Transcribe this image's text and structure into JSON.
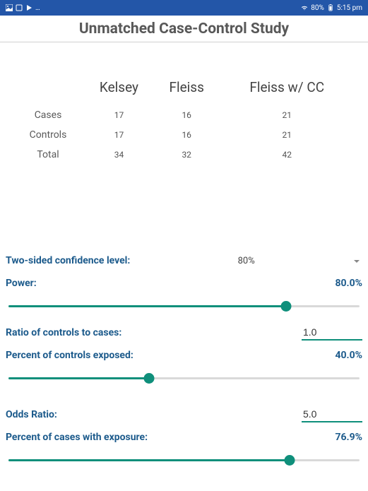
{
  "status": {
    "icons_left": [
      "image-icon",
      "square-icon",
      "play-icon",
      "…"
    ],
    "wifi": "wifi-icon",
    "battery_text": "80%",
    "battery_icon": "battery-icon",
    "time": "5:15 pm"
  },
  "title": "Unmatched Case-Control Study",
  "table": {
    "columns": [
      "Kelsey",
      "Fleiss",
      "Fleiss w/ CC"
    ],
    "rows": [
      {
        "label": "Cases",
        "values": [
          "17",
          "16",
          "21"
        ]
      },
      {
        "label": "Controls",
        "values": [
          "17",
          "16",
          "21"
        ]
      },
      {
        "label": "Total",
        "values": [
          "34",
          "32",
          "42"
        ]
      }
    ]
  },
  "params": {
    "confidence": {
      "label": "Two-sided confidence level:",
      "value": "80%"
    },
    "power": {
      "label": "Power:",
      "value": "80.0%",
      "slider_pct": 79
    },
    "ratio": {
      "label": "Ratio of controls to cases:",
      "value": "1.0"
    },
    "controls_exposed": {
      "label": "Percent of controls exposed:",
      "value": "40.0%",
      "slider_pct": 40
    },
    "odds_ratio": {
      "label": "Odds Ratio:",
      "value": "5.0"
    },
    "cases_exposure": {
      "label": "Percent of cases with exposure:",
      "value": "76.9%",
      "slider_pct": 80
    }
  }
}
